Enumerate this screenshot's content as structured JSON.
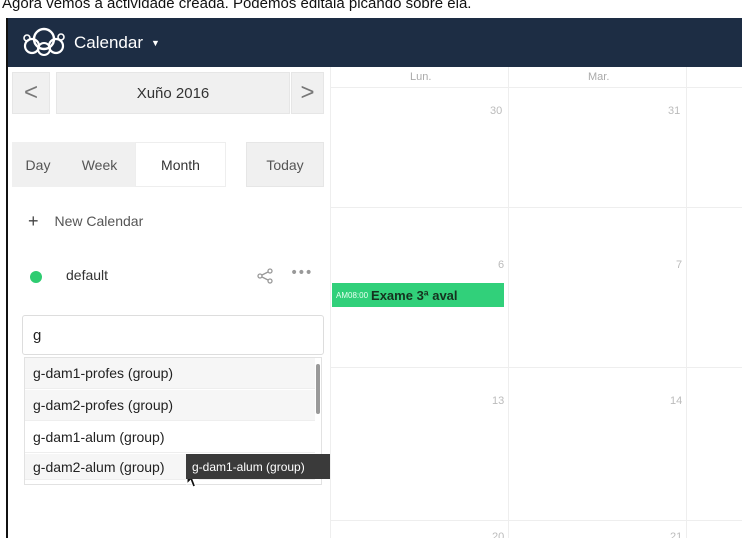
{
  "caption": "Agora vemos a actividade creada. Podemos editala picando sobre ela.",
  "header": {
    "app_name": "Calendar"
  },
  "nav": {
    "prev": "<",
    "month_label": "Xuño 2016",
    "next": ">"
  },
  "views": {
    "day": "Day",
    "week": "Week",
    "month": "Month",
    "today": "Today"
  },
  "sidebar": {
    "new_calendar": "New Calendar",
    "calendar": {
      "name": "default",
      "color": "#2ecc71"
    }
  },
  "share": {
    "input_value": "g",
    "suggestions": [
      "g-dam1-profes (group)",
      "g-dam2-profes (group)",
      "g-dam1-alum (group)",
      "g-dam2-alum (group)"
    ],
    "tooltip": "g-dam1-alum (group)"
  },
  "calendar_grid": {
    "weekdays": [
      "Lun.",
      "Mar."
    ],
    "rows": [
      [
        "30",
        "31"
      ],
      [
        "6",
        "7"
      ],
      [
        "13",
        "14"
      ],
      [
        "20",
        "21"
      ]
    ]
  },
  "event": {
    "time": "AM08:00",
    "title": "Exame 3ª aval",
    "color": "#31d07a"
  }
}
